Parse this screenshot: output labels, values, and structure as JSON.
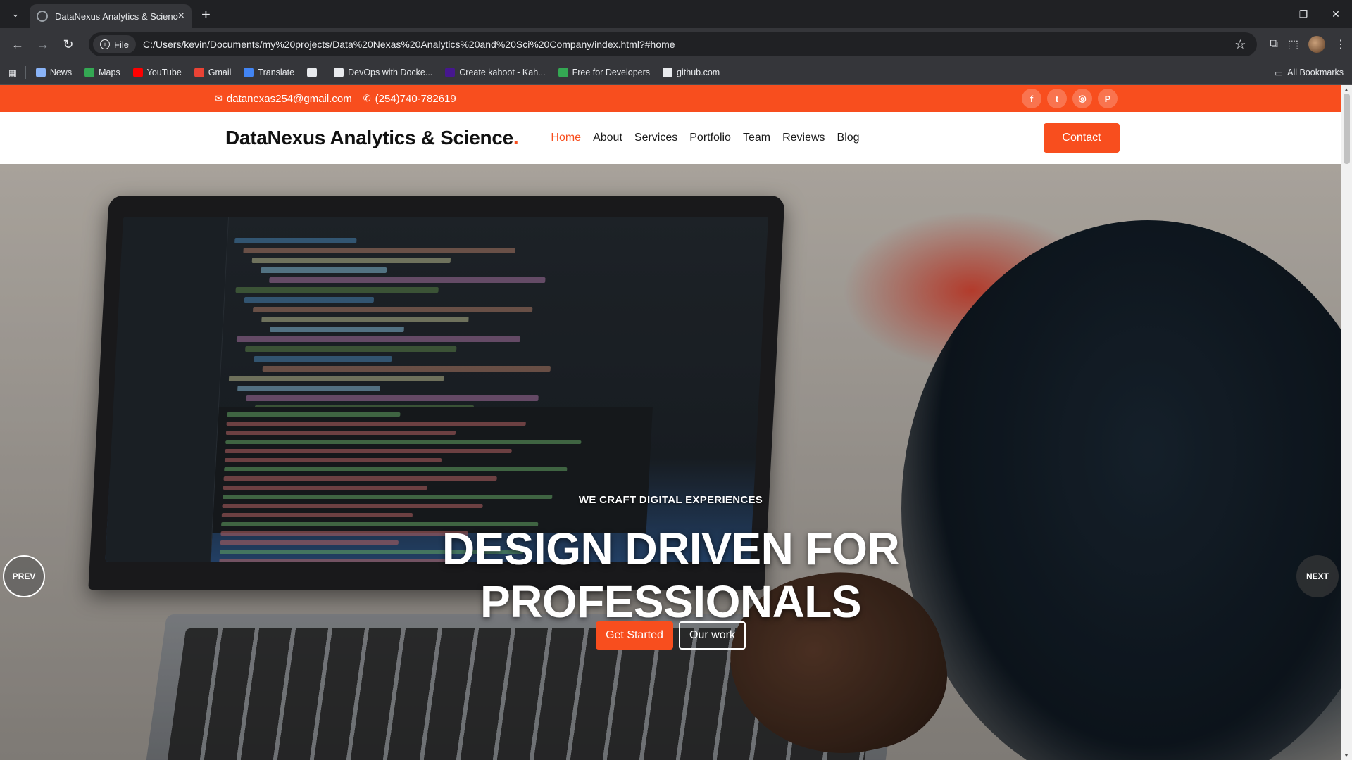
{
  "browser": {
    "tab_title": "DataNexus Analytics & Science",
    "url_chip": "File",
    "url": "C:/Users/kevin/Documents/my%20projects/Data%20Nexas%20Analytics%20and%20Sci%20Company/index.html?#home",
    "bookmarks": [
      {
        "label": "News",
        "icon": "news-icon",
        "color": "#8ab4f8"
      },
      {
        "label": "Maps",
        "icon": "maps-icon",
        "color": "#34a853"
      },
      {
        "label": "YouTube",
        "icon": "youtube-icon",
        "color": "#ff0000"
      },
      {
        "label": "Gmail",
        "icon": "gmail-icon",
        "color": "#ea4335"
      },
      {
        "label": "Translate",
        "icon": "translate-icon",
        "color": "#4285f4"
      },
      {
        "label": "",
        "icon": "globe-icon",
        "color": "#e8eaed"
      },
      {
        "label": "DevOps with Docke...",
        "icon": "devops-icon",
        "color": "#e8eaed"
      },
      {
        "label": "Create kahoot - Kah...",
        "icon": "kahoot-icon",
        "color": "#46178f"
      },
      {
        "label": "Free for Developers",
        "icon": "free-dev-icon",
        "color": "#34a853"
      },
      {
        "label": "github.com",
        "icon": "github-icon",
        "color": "#e8eaed"
      }
    ],
    "all_bookmarks": "All Bookmarks"
  },
  "site": {
    "topbar": {
      "email": "datanexas254@gmail.com",
      "phone": "(254)740-782619",
      "socials": [
        "facebook-icon",
        "twitter-icon",
        "instagram-icon",
        "pinterest-icon"
      ]
    },
    "logo": "DataNexus Analytics & Science",
    "logo_dot": ".",
    "nav": [
      "Home",
      "About",
      "Services",
      "Portfolio",
      "Team",
      "Reviews",
      "Blog"
    ],
    "active_nav": "Home",
    "contact_button": "Contact",
    "hero": {
      "eyebrow": "WE CRAFT DIGITAL EXPERIENCES",
      "headline_line1": "DESIGN DRIVEN FOR",
      "headline_line2": "PROFESSIONALS",
      "primary_button": "Get Started",
      "secondary_button": "Our work",
      "prev": "PREV",
      "next": "NEXT"
    }
  },
  "colors": {
    "accent": "#f84e1e",
    "browser_bg": "#202124",
    "toolbar_bg": "#35363a"
  }
}
